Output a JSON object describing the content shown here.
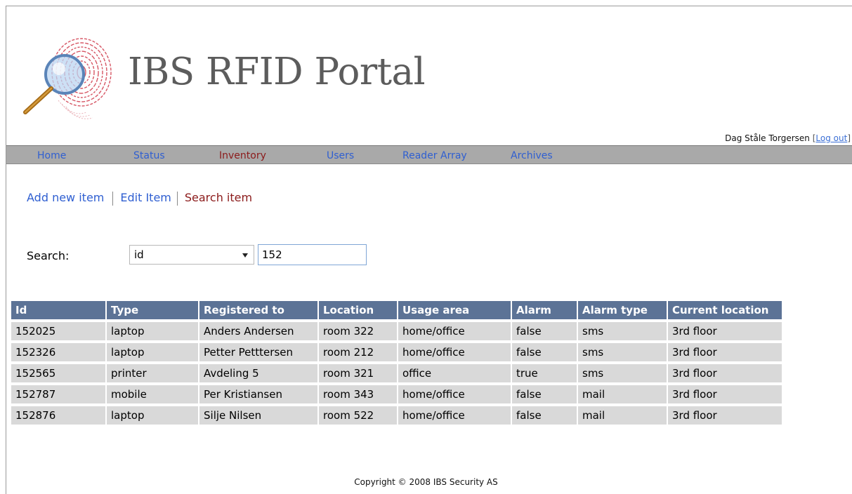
{
  "header": {
    "title": "IBS RFID Portal"
  },
  "user": {
    "name": "Dag Ståle Torgersen",
    "bracket_open": "[",
    "logout_label": "Log out",
    "bracket_close": "]"
  },
  "nav": {
    "items": [
      {
        "label": "Home",
        "active": false
      },
      {
        "label": "Status",
        "active": false
      },
      {
        "label": "Inventory",
        "active": true
      },
      {
        "label": "Users",
        "active": false
      },
      {
        "label": "Reader Array",
        "active": false
      },
      {
        "label": "Archives",
        "active": false
      }
    ],
    "link_color": "#2f5fd1",
    "active_color": "#8b1a1a",
    "bar_color": "#a9a9a9"
  },
  "subnav": {
    "items": [
      {
        "label": "Add new item",
        "active": false
      },
      {
        "label": "Edit Item",
        "active": false
      },
      {
        "label": "Search item",
        "active": true
      }
    ]
  },
  "search": {
    "label": "Search:",
    "field_selected": "id",
    "query": "152"
  },
  "table": {
    "header_color": "#5c7396",
    "row_color": "#d9d9d9",
    "columns": [
      "Id",
      "Type",
      "Registered to",
      "Location",
      "Usage area",
      "Alarm",
      "Alarm type",
      "Current location"
    ],
    "rows": [
      [
        "152025",
        "laptop",
        "Anders Andersen",
        "room 322",
        "home/office",
        "false",
        "sms",
        "3rd floor"
      ],
      [
        "152326",
        "laptop",
        "Petter Petttersen",
        "room 212",
        "home/office",
        "false",
        "sms",
        "3rd floor"
      ],
      [
        "152565",
        "printer",
        "Avdeling 5",
        "room 321",
        "office",
        "true",
        "sms",
        "3rd floor"
      ],
      [
        "152787",
        "mobile",
        "Per Kristiansen",
        "room 343",
        "home/office",
        "false",
        "mail",
        "3rd floor"
      ],
      [
        "152876",
        "laptop",
        "Silje Nilsen",
        "room 522",
        "home/office",
        "false",
        "mail",
        "3rd floor"
      ]
    ]
  },
  "footer": {
    "copyright": "Copyright © 2008 IBS Security AS"
  }
}
